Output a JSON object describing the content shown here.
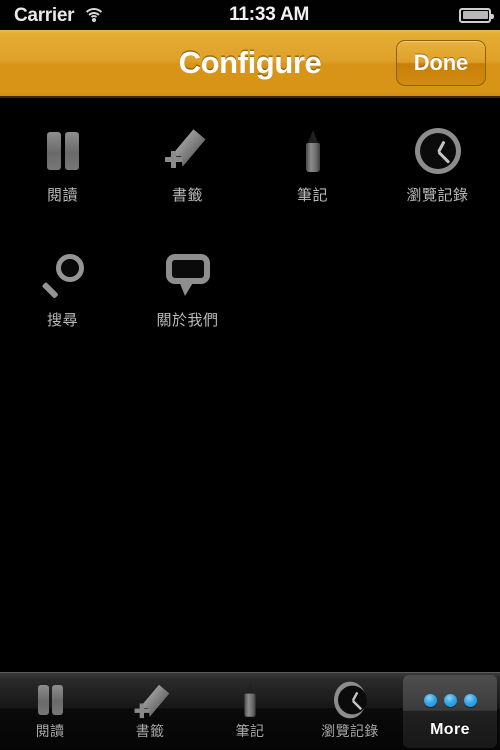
{
  "status_bar": {
    "carrier": "Carrier",
    "wifi_icon": "wifi-icon",
    "time": "11:33 AM",
    "battery_icon": "battery-full-icon"
  },
  "nav_bar": {
    "title": "Configure",
    "done_label": "Done",
    "accent_color": "#dfa12a",
    "title_color": "#ffffff"
  },
  "grid": {
    "items": [
      {
        "label": "閱讀",
        "icon": "book-icon"
      },
      {
        "label": "書籤",
        "icon": "bookmark-add-icon"
      },
      {
        "label": "筆記",
        "icon": "pen-icon"
      },
      {
        "label": "瀏覽記錄",
        "icon": "clock-icon"
      },
      {
        "label": "搜尋",
        "icon": "search-icon"
      },
      {
        "label": "關於我們",
        "icon": "speech-bubble-icon"
      }
    ]
  },
  "tab_bar": {
    "items": [
      {
        "label": "閱讀",
        "icon": "book-icon",
        "selected": false
      },
      {
        "label": "書籤",
        "icon": "bookmark-add-icon",
        "selected": false
      },
      {
        "label": "筆記",
        "icon": "pen-icon",
        "selected": false
      },
      {
        "label": "瀏覽記錄",
        "icon": "clock-icon",
        "selected": false
      },
      {
        "label": "More",
        "icon": "more-dots-icon",
        "selected": true
      }
    ],
    "selected_dot_color": "#34a6e8"
  }
}
